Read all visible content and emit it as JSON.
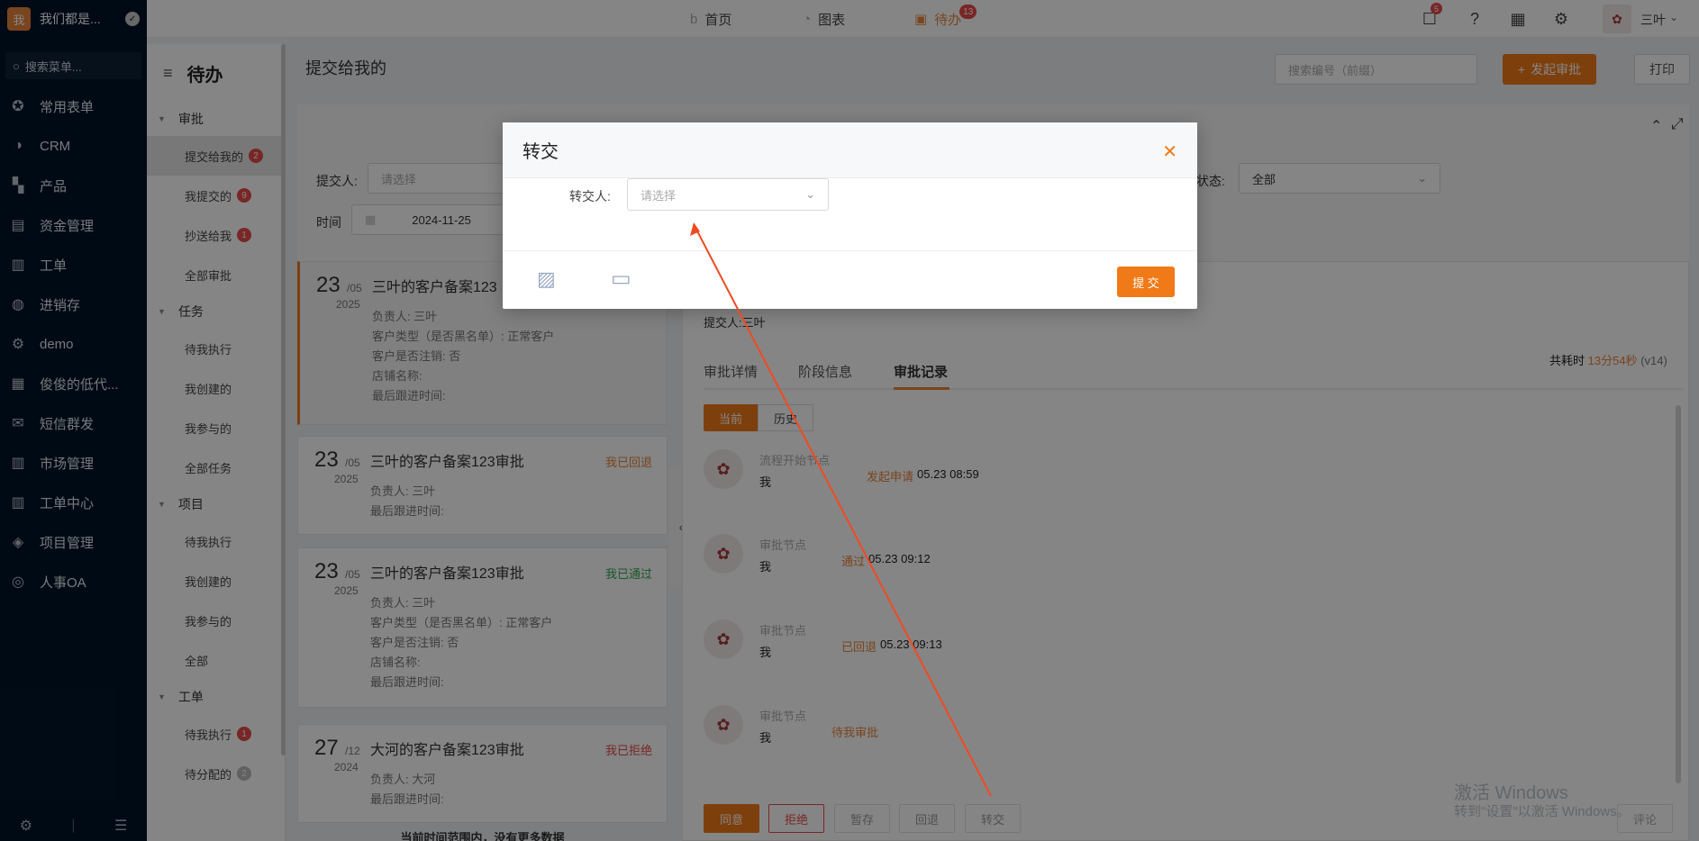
{
  "nav": {
    "logo_char": "我",
    "brand": "我们都是...",
    "search_placeholder": "搜索菜单...",
    "items": [
      {
        "label": "常用表单",
        "icon": "star-icon"
      },
      {
        "label": "CRM",
        "icon": "pie-icon"
      },
      {
        "label": "产品",
        "icon": "grid-icon"
      },
      {
        "label": "资金管理",
        "icon": "money-icon"
      },
      {
        "label": "工单",
        "icon": "clipboard-icon"
      },
      {
        "label": "进销存",
        "icon": "cycle-icon"
      },
      {
        "label": "demo",
        "icon": "gear-icon"
      },
      {
        "label": "俊俊的低代...",
        "icon": "chart-icon"
      },
      {
        "label": "短信群发",
        "icon": "mail-icon"
      },
      {
        "label": "市场管理",
        "icon": "clipboard-icon"
      },
      {
        "label": "工单中心",
        "icon": "clipboard-icon"
      },
      {
        "label": "项目管理",
        "icon": "layers-icon"
      },
      {
        "label": "人事OA",
        "icon": "globe-icon"
      }
    ]
  },
  "topbar": {
    "tabs": [
      "首页",
      "图表",
      "待办"
    ],
    "todo_badge": "13",
    "msg_badge": "5",
    "user": "三叶"
  },
  "subnav": {
    "title": "待办",
    "groups": [
      {
        "label": "审批",
        "items": [
          {
            "label": "提交给我的",
            "badge": "2",
            "active": true
          },
          {
            "label": "我提交的",
            "badge": "9"
          },
          {
            "label": "抄送给我",
            "badge": "1"
          },
          {
            "label": "全部审批",
            "badge": ""
          }
        ]
      },
      {
        "label": "任务",
        "items": [
          {
            "label": "待我执行",
            "badge": ""
          },
          {
            "label": "我创建的",
            "badge": ""
          },
          {
            "label": "我参与的",
            "badge": ""
          },
          {
            "label": "全部任务",
            "badge": ""
          }
        ]
      },
      {
        "label": "项目",
        "items": [
          {
            "label": "待我执行",
            "badge": ""
          },
          {
            "label": "我创建的",
            "badge": ""
          },
          {
            "label": "我参与的",
            "badge": ""
          },
          {
            "label": "全部",
            "badge": ""
          }
        ]
      },
      {
        "label": "工单",
        "items": [
          {
            "label": "待我执行",
            "badge": "1"
          },
          {
            "label": "待分配的",
            "badge": "2",
            "gray": true
          }
        ]
      }
    ]
  },
  "main": {
    "title": "提交给我的",
    "search_placeholder": "搜索编号（前缀）",
    "start_button": "发起审批",
    "print_button": "打印",
    "filter_submitter_label": "提交人:",
    "filter_submitter_placeholder": "请选择",
    "filter_time_label": "时间",
    "filter_time_value": "2024-11-25",
    "filter_status_label": "状态:",
    "filter_status_value": "全部",
    "list": [
      {
        "day": "23",
        "mo": "/05",
        "yr": "2025",
        "title": "三叶的客户备案123",
        "status": "",
        "lines": [
          "负责人: 三叶",
          "客户类型（是否黑名单）: 正常客户",
          "客户是否注销: 否",
          "店铺名称:",
          "最后跟进时间:"
        ]
      },
      {
        "day": "23",
        "mo": "/05",
        "yr": "2025",
        "title": "三叶的客户备案123审批",
        "status": "我已回退",
        "lines": [
          "负责人: 三叶",
          "最后跟进时间:"
        ]
      },
      {
        "day": "23",
        "mo": "/05",
        "yr": "2025",
        "title": "三叶的客户备案123审批",
        "status": "我已通过",
        "lines": [
          "负责人: 三叶",
          "客户类型（是否黑名单）: 正常客户",
          "客户是否注销: 否",
          "店铺名称:",
          "最后跟进时间:"
        ]
      },
      {
        "day": "27",
        "mo": "/12",
        "yr": "2024",
        "title": "大河的客户备案123审批",
        "status": "我已拒绝",
        "lines": [
          "负责人: 大河",
          "最后跟进时间:"
        ]
      }
    ],
    "list_footer": "当前时间范围内，没有更多数据",
    "detail": {
      "submitter": "提交人:三叶",
      "elapsed_label": "共耗时",
      "elapsed_value": "13分54秒",
      "version": "(v14)",
      "tabs": [
        "审批详情",
        "阶段信息",
        "审批记录"
      ],
      "toggle": [
        "当前",
        "历史"
      ],
      "nodes": [
        {
          "label": "流程开始节点",
          "who": "我",
          "action": "发起申请",
          "time": "05.23 08:59"
        },
        {
          "label": "审批节点",
          "who": "我",
          "action": "通过",
          "time": "05.23 09:12"
        },
        {
          "label": "审批节点",
          "who": "我",
          "action": "已回退",
          "time": "05.23 09:13"
        },
        {
          "label": "审批节点",
          "who": "我",
          "action": "待我审批",
          "time": ""
        }
      ],
      "actions": [
        "同意",
        "拒绝",
        "暂存",
        "回退",
        "转交",
        "评论"
      ]
    }
  },
  "modal": {
    "title": "转交",
    "field_label": "转交人:",
    "field_placeholder": "请选择",
    "submit": "提 交"
  },
  "watermark": {
    "line1": "激活 Windows",
    "line2": "转到\"设置\"以激活 Windows。"
  },
  "colors": {
    "accent": "#f07a17",
    "nav_bg": "#001529"
  }
}
